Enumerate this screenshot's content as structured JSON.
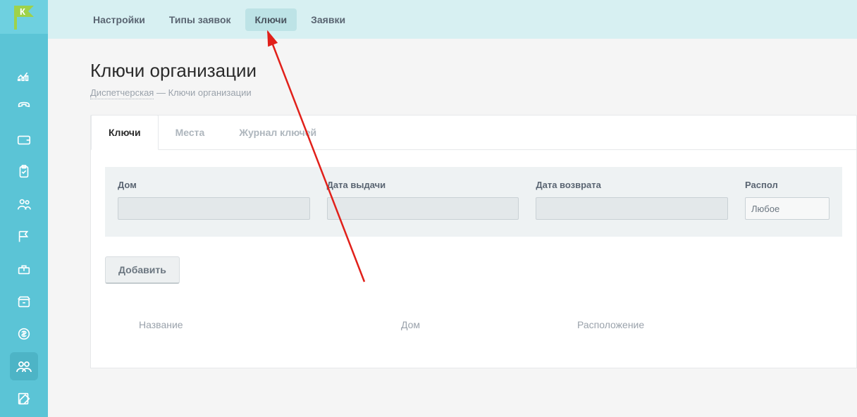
{
  "sidebar": {
    "logo_letter": "К"
  },
  "topnav": {
    "items": [
      {
        "label": "Настройки",
        "active": false
      },
      {
        "label": "Типы заявок",
        "active": false
      },
      {
        "label": "Ключи",
        "active": true
      },
      {
        "label": "Заявки",
        "active": false
      }
    ]
  },
  "page": {
    "title": "Ключи организации",
    "breadcrumb_link": "Диспетчерская",
    "breadcrumb_sep": " — ",
    "breadcrumb_current": "Ключи организации"
  },
  "tabs": [
    {
      "label": "Ключи",
      "active": true
    },
    {
      "label": "Места",
      "active": false
    },
    {
      "label": "Журнал ключей",
      "active": false
    }
  ],
  "filters": {
    "house": {
      "label": "Дом",
      "value": ""
    },
    "issue": {
      "label": "Дата выдачи",
      "value": ""
    },
    "return": {
      "label": "Дата возврата",
      "value": ""
    },
    "location": {
      "label": "Распол",
      "value": "Любое"
    }
  },
  "buttons": {
    "add": "Добавить"
  },
  "table": {
    "columns": {
      "name": "Название",
      "house": "Дом",
      "location": "Расположение"
    },
    "rows": []
  }
}
